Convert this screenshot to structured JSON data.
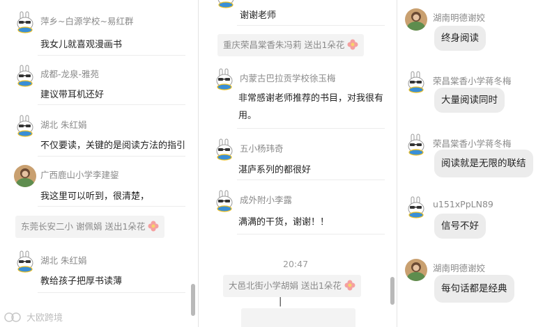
{
  "panel1": {
    "messages": [
      {
        "name": "萍乡~白源学校~易红群",
        "text": "我女儿就喜观漫画书",
        "avatar": "rabbit-avatar"
      },
      {
        "name": "成都-龙泉-雅苑",
        "text": "建议带耳机还好",
        "avatar": "rabbit-avatar"
      },
      {
        "name": "湖北  朱红娟",
        "text": "不仅要读，关键的是阅读方法的指引",
        "avatar": "rabbit-avatar"
      },
      {
        "name": "广西鹿山小学李建鋆",
        "text": "我这里可以听到，很清楚，",
        "avatar": "photo-avatar"
      },
      {
        "name": "湖北  朱红娟",
        "text": "教给孩子把厚书读薄",
        "avatar": "rabbit-avatar"
      }
    ],
    "system": "东莞长安二小  谢佩娟 送出1朵花"
  },
  "panel2": {
    "top_text": "谢谢老师",
    "system1": "重庆荣昌棠香朱冯莉 送出1朵花",
    "messages": [
      {
        "name": "内蒙古巴拉贡学校徐玉梅",
        "text": "非常感谢老师推荐的书目，对我很有用。",
        "avatar": "rabbit-avatar"
      },
      {
        "name": "五小杨玮奇",
        "text": "湛庐系列的都很好",
        "avatar": "rabbit-avatar"
      },
      {
        "name": "成外附小李露",
        "text": "满满的干货，谢谢！！",
        "avatar": "rabbit-avatar"
      }
    ],
    "time": "20:47",
    "system2": "大邑北街小学胡娟 送出1朵花",
    "input_cursor": "|"
  },
  "panel3": {
    "messages": [
      {
        "name": "湖南明德谢姣",
        "text": "终身阅读",
        "avatar": "photo-avatar"
      },
      {
        "name": "荣昌棠香小学蒋冬梅",
        "text": "大量阅读同时",
        "avatar": "rabbit-avatar"
      },
      {
        "name": "荣昌棠香小学蒋冬梅",
        "text": "阅读就是无限的联结",
        "avatar": "rabbit-avatar"
      },
      {
        "name": "u151xPpLN89",
        "text": "信号不好",
        "avatar": "rabbit-avatar"
      },
      {
        "name": "湖南明德谢姣",
        "text": "每句话都是经典",
        "avatar": "photo-avatar"
      }
    ]
  },
  "watermark": "大欧跨境",
  "colors": {
    "bubble": "#ececec",
    "system_bg": "#f3f3f3",
    "flower": "#f08a8a",
    "name": "#8a8a8a"
  }
}
